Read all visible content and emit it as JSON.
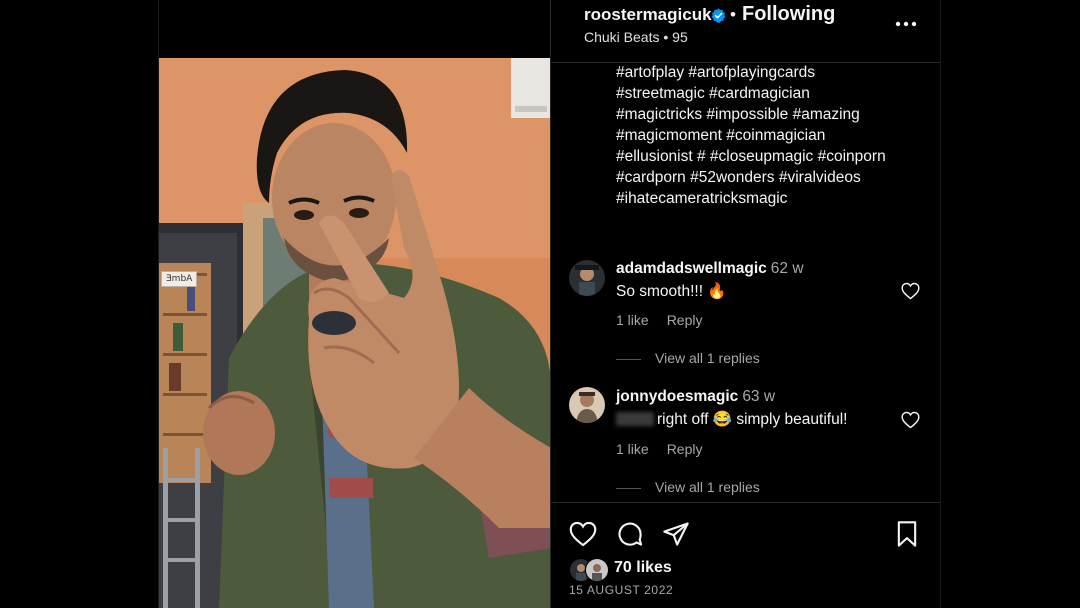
{
  "post": {
    "username": "roostermagicuk",
    "verified_icon": "verified-badge-icon",
    "separator": "•",
    "follow_label": "Following",
    "audio": "Chuki Beats • 95",
    "more_icon": "more-horizontal-icon"
  },
  "media": {
    "sign_text": "ƎmbA"
  },
  "caption": {
    "lines": [
      "#artofplay #artofplayingcards",
      "#streetmagic #cardmagician",
      "#magictricks #impossible #amazing",
      "#magicmoment #coinmagician",
      "#ellusionist # #closeupmagic #coinporn",
      "#cardporn #52wonders #viralvideos",
      "#ihatecameratricksmagic"
    ]
  },
  "comments": [
    {
      "username": "adamdadswellmagic",
      "time": "62 w",
      "text": "So smooth!!! 🔥",
      "likes": "1 like",
      "reply": "Reply",
      "view_replies": "View all 1 replies"
    },
    {
      "username": "jonnydoesmagic",
      "time": "63 w",
      "text": "right off 😂 simply beautiful!",
      "likes": "1 like",
      "reply": "Reply",
      "view_replies": "View all 1 replies"
    }
  ],
  "actions": {
    "like_icon": "heart-icon",
    "comment_icon": "comment-icon",
    "share_icon": "send-icon",
    "save_icon": "bookmark-icon",
    "likes": "70 likes",
    "date": "15 AUGUST 2022"
  },
  "colors": {
    "background": "#000000",
    "text": "#f5f5f5",
    "muted": "#a8a8a8",
    "verified": "#0095f6",
    "divider": "#262626"
  }
}
